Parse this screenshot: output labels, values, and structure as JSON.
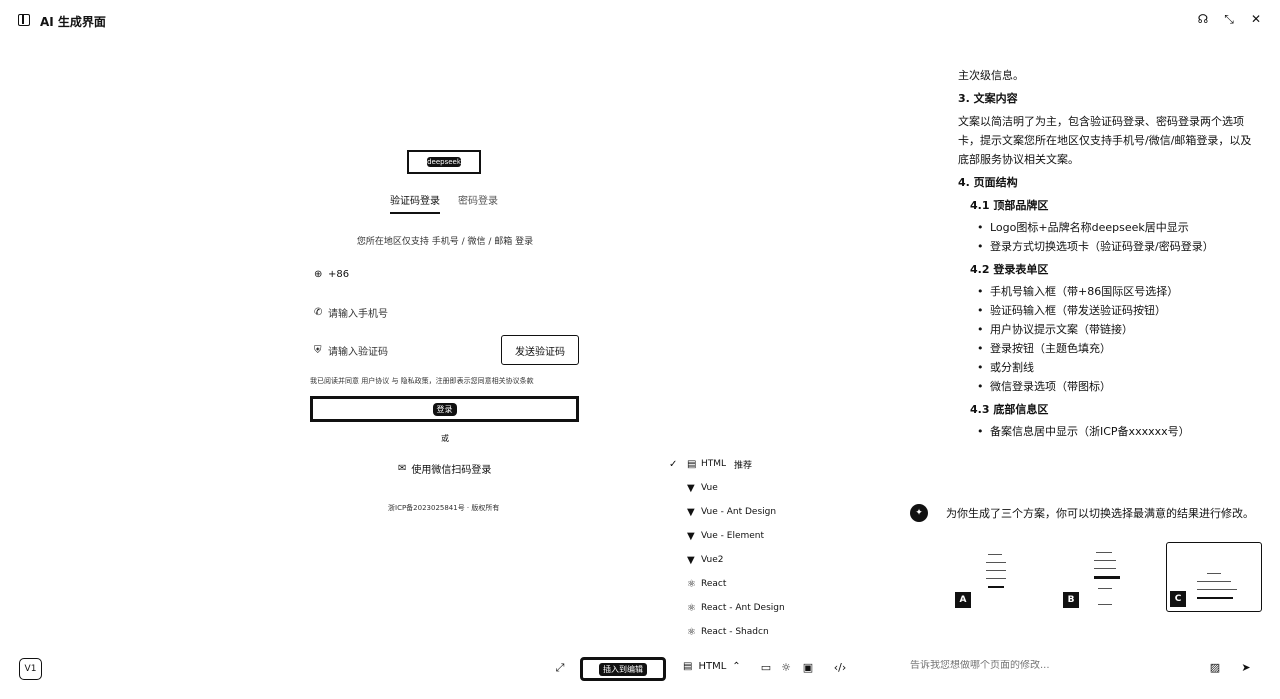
{
  "app": {
    "title": "AI 生成界面"
  },
  "topbar": {
    "icons": [
      "headset-icon",
      "collapse-icon",
      "close-icon"
    ]
  },
  "preview": {
    "logo_text": "deepseek",
    "tabs": [
      {
        "label": "验证码登录",
        "active": true
      },
      {
        "label": "密码登录",
        "active": false
      }
    ],
    "region_hint": "您所在地区仅支持 手机号 / 微信 / 邮箱 登录",
    "country_code": "+86",
    "phone_placeholder": "请输入手机号",
    "code_placeholder": "请输入验证码",
    "send_code_label": "发送验证码",
    "agreement": "我已阅读并同意 用户协议 与 隐私政策，注册即表示您同意相关协议条款",
    "login_label": "登录",
    "or_label": "或",
    "wechat_label": "使用微信扫码登录",
    "icp": "浙ICP备2023025841号 · 版权所有"
  },
  "frameworks": {
    "items": [
      {
        "label": "HTML",
        "badge": "推荐",
        "icon": "html-icon",
        "selected": true
      },
      {
        "label": "Vue",
        "badge": "",
        "icon": "vue-icon",
        "selected": false
      },
      {
        "label": "Vue - Ant Design",
        "badge": "",
        "icon": "vue-icon",
        "selected": false
      },
      {
        "label": "Vue - Element",
        "badge": "",
        "icon": "vue-icon",
        "selected": false
      },
      {
        "label": "Vue2",
        "badge": "",
        "icon": "vue-icon",
        "selected": false
      },
      {
        "label": "React",
        "badge": "",
        "icon": "react-icon",
        "selected": false
      },
      {
        "label": "React - Ant Design",
        "badge": "",
        "icon": "react-icon",
        "selected": false
      },
      {
        "label": "React - Shadcn",
        "badge": "",
        "icon": "react-icon",
        "selected": false
      }
    ]
  },
  "doc": {
    "intro_tail": "主次级信息。",
    "section3_title": "3. 文案内容",
    "section3_text": "文案以简洁明了为主，包含验证码登录、密码登录两个选项卡，提示文案您所在地区仅支持手机号/微信/邮箱登录，以及底部服务协议相关文案。",
    "section4_title": "4. 页面结构",
    "sub41": "4.1 顶部品牌区",
    "list41": [
      "Logo图标+品牌名称deepseek居中显示",
      "登录方式切换选项卡（验证码登录/密码登录）"
    ],
    "sub42": "4.2 登录表单区",
    "list42": [
      "手机号输入框（带+86国际区号选择）",
      "验证码输入框（带发送验证码按钮）",
      "用户协议提示文案（带链接）",
      "登录按钮（主题色填充）",
      "或分割线",
      "微信登录选项（带图标）"
    ],
    "sub43": "4.3 底部信息区",
    "list43": [
      "备案信息居中显示（浙ICP备xxxxxx号）"
    ]
  },
  "ai_message": {
    "text": "为你生成了三个方案，你可以切换选择最满意的结果进行修改。"
  },
  "variants": [
    {
      "label": "A",
      "selected": false
    },
    {
      "label": "B",
      "selected": false
    },
    {
      "label": "C",
      "selected": true
    }
  ],
  "bottombar": {
    "version": "V1",
    "insert_label": "插入到编辑",
    "language": "HTML",
    "input_placeholder": "告诉我您想做哪个页面的修改..."
  }
}
